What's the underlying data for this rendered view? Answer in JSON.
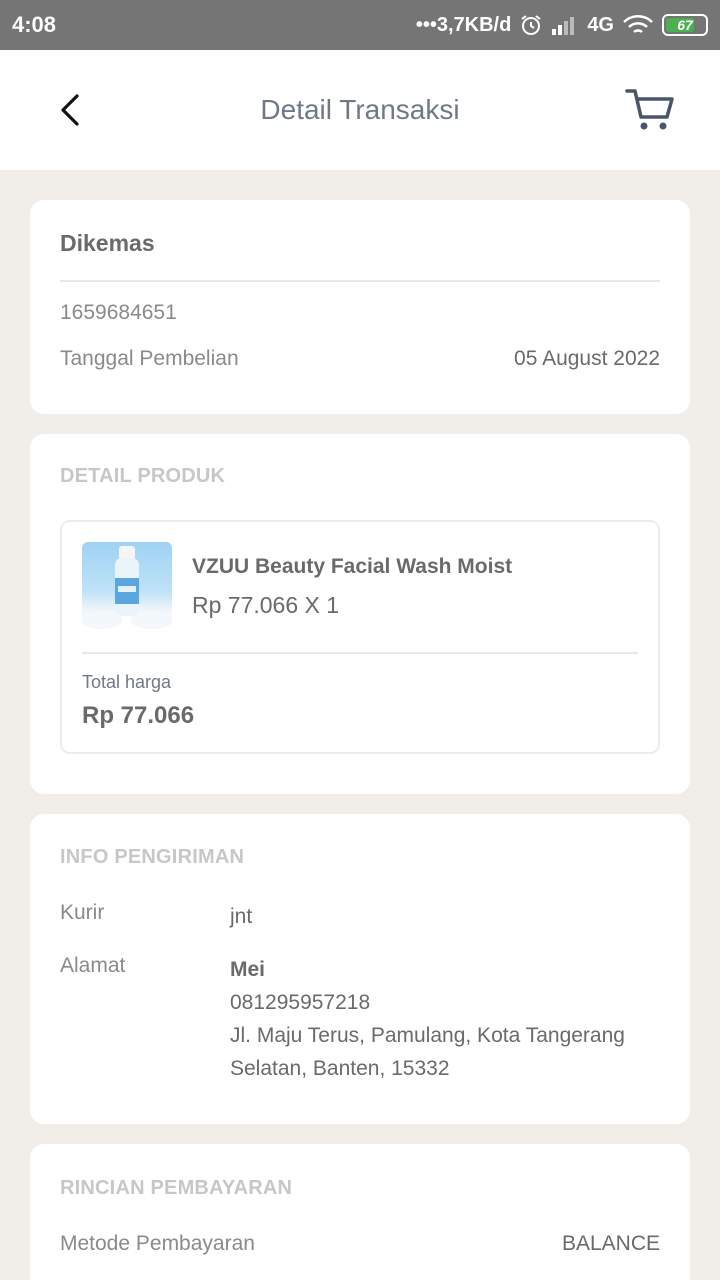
{
  "status_bar": {
    "time": "4:08",
    "network_speed": "•••3,7KB/d",
    "network_type": "4G",
    "battery": "67"
  },
  "header": {
    "title": "Detail Transaksi",
    "back_icon": "chevron-left-icon",
    "cart_icon": "cart-icon"
  },
  "order": {
    "status": "Dikemas",
    "id": "1659684651",
    "date_label": "Tanggal Pembelian",
    "date_value": "05 August 2022"
  },
  "product_section": {
    "title": "DETAIL PRODUK",
    "name": "VZUU Beauty Facial Wash Moist",
    "price_qty": "Rp 77.066 X 1",
    "total_label": "Total harga",
    "total_value": "Rp 77.066"
  },
  "shipping": {
    "title": "INFO PENGIRIMAN",
    "courier_label": "Kurir",
    "courier_value": "jnt",
    "address_label": "Alamat",
    "recipient": "Mei",
    "phone": "081295957218",
    "address_line1": "Jl. Maju Terus, Pamulang, Kota Tangerang",
    "address_line2": "Selatan, Banten, 15332"
  },
  "payment": {
    "title": "RINCIAN PEMBAYARAN",
    "method_label": "Metode Pembayaran",
    "method_value": "BALANCE"
  },
  "colors": {
    "page_bg": "#f1eeea",
    "statusbar_bg": "#757575",
    "title_text": "#707888",
    "section_title": "#c7c7c7"
  }
}
